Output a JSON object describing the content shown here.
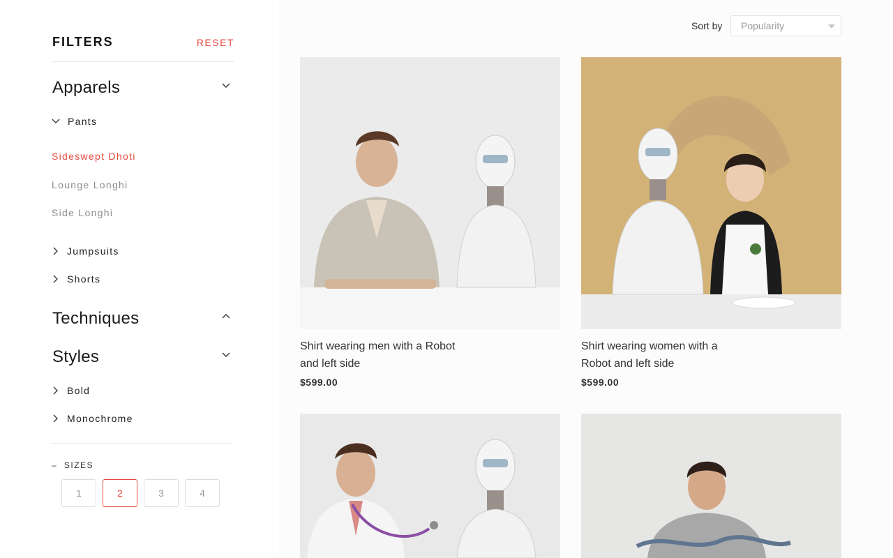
{
  "sidebar": {
    "title": "FILTERS",
    "reset_label": "RESET",
    "apparels": {
      "title": "Apparels",
      "pants_label": "Pants",
      "pants_items": [
        "Sideswept Dhoti",
        "Lounge Longhi",
        "Side Longhi"
      ],
      "jumpsuits_label": "Jumpsuits",
      "shorts_label": "Shorts"
    },
    "techniques": {
      "title": "Techniques"
    },
    "styles": {
      "title": "Styles",
      "items": [
        "Bold",
        "Monochrome"
      ]
    },
    "sizes": {
      "label": "SIZES",
      "collapse_glyph": "–",
      "options": [
        "1",
        "2",
        "3",
        "4"
      ],
      "selected": "2"
    }
  },
  "main": {
    "sort_label": "Sort by",
    "sort_value": "Popularity",
    "products": [
      {
        "title": "Shirt wearing men with a Robot and left side",
        "price": "$599.00"
      },
      {
        "title": "Shirt wearing women with a Robot and left side",
        "price": "$599.00"
      },
      {
        "title": "",
        "price": ""
      },
      {
        "title": "",
        "price": ""
      }
    ]
  },
  "colors": {
    "accent": "#e8493f",
    "muted_text": "#8c8c8c",
    "divider": "#e6e6e6"
  },
  "icons": {
    "section_expand": "chevron-down-icon",
    "section_collapse": "chevron-up-icon",
    "item_collapsed": "chevron-right-icon",
    "item_expanded": "chevron-down-icon",
    "select_caret": "caret-down-icon"
  }
}
